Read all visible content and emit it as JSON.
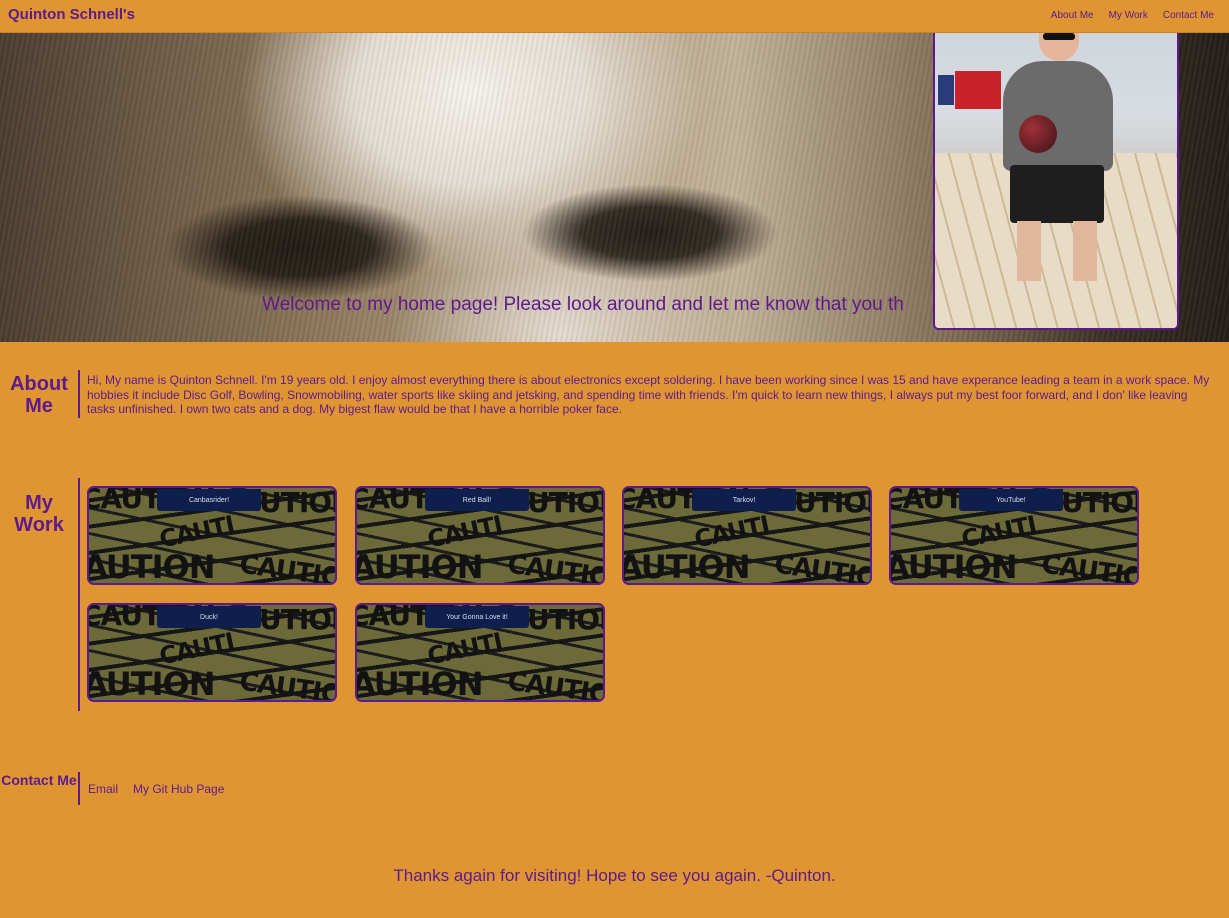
{
  "header": {
    "title": "Quinton Schnell's",
    "nav": [
      "About Me",
      "My Work",
      "Contact Me"
    ]
  },
  "hero": {
    "welcome": "Welcome to my home page! Please look around and let me know that you th"
  },
  "about": {
    "label": "About Me",
    "text": "Hi, My name is Quinton Schnell. I'm 19 years old. I enjoy almost everything there is about electronics except soldering. I have been working since I was 15 and have experance leading a team in a work space. My hobbies it include Disc Golf, Bowling, Snowmobiling, water sports like skiing and jetsking, and spending time with friends. I'm quick to learn new things, I always put my best foor forward, and I don' like leaving tasks unfinished. I own two cats and a dog. My bigest flaw would be that I have a horrible poker face."
  },
  "work": {
    "label": "My Work",
    "cards": [
      "Canbasrider!",
      "Red Ball!",
      "Tarkov!",
      "YouTube!",
      "Duck!",
      "Your Gonna Love it!"
    ]
  },
  "contact": {
    "label": "Contact Me",
    "links": [
      "Email",
      "My Git Hub Page"
    ]
  },
  "footer": {
    "text": "Thanks again for visiting! Hope to see you again. -Quinton."
  },
  "colors": {
    "background": "#e09533",
    "accent": "#5c1a8c",
    "card_tab": "#0e1f4d"
  }
}
